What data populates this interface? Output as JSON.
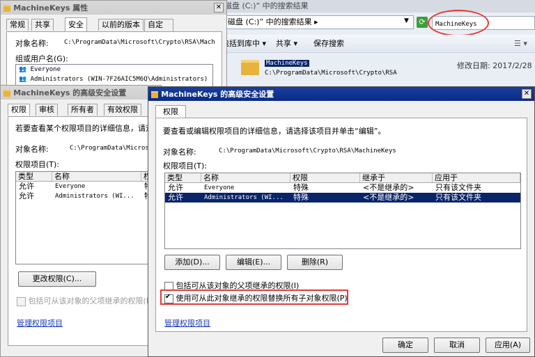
{
  "explorer": {
    "title": "磁盘 (C:)” 中的搜索结果",
    "address": "磁盘 (C:)” 中的搜索结果 ▸",
    "search_value": "MachineKeys",
    "toolbar": [
      "包括到库中 ▾",
      "共享 ▾",
      "保存搜索"
    ],
    "result_name": "MachineKeys",
    "result_path": "C:\\ProgramData\\Microsoft\\Crypto\\RSA",
    "result_date": "修改日期: 2017/2/28 20"
  },
  "props": {
    "title": "MachineKeys 属性",
    "tabs": [
      "常规",
      "共享",
      "安全",
      "以前的版本",
      "自定义"
    ],
    "object_label": "对象名称:",
    "object_value": "C:\\ProgramData\\Microsoft\\Crypto\\RSA\\Mach",
    "group_label": "组或用户名(G):",
    "users": [
      "Everyone",
      "Administrators (WIN-7F26AIC5M6Q\\Administrators)"
    ]
  },
  "adv1": {
    "title": "MachineKeys 的高级安全设置",
    "tabs": [
      "权限",
      "审核",
      "所有者",
      "有效权限"
    ],
    "desc": "若要查看某个权限项目的详细信息，请双",
    "object_label": "对象名称:",
    "object_value": "C:\\ProgramData\\Micros",
    "entries_label": "权限项目(T):",
    "headers": [
      "类型",
      "名称",
      "权"
    ],
    "rows": [
      {
        "type": "允许",
        "name": "Everyone",
        "perm": "特"
      },
      {
        "type": "允许",
        "name": "Administrators (WI...",
        "perm": "特"
      }
    ],
    "change_btn": "更改权限(C)...",
    "inherit_label": "包括可从该对象的父项继承的权限(I)",
    "manage_link": "管理权限项目"
  },
  "adv2": {
    "title": "MachineKeys 的高级安全设置",
    "tab": "权限",
    "desc": "要查看或编辑权限项目的详细信息，请选择该项目并单击“编辑”。",
    "object_label": "对象名称:",
    "object_value": "C:\\ProgramData\\Microsoft\\Crypto\\RSA\\MachineKeys",
    "entries_label": "权限项目(T):",
    "headers": [
      "类型",
      "名称",
      "权限",
      "继承于",
      "应用于"
    ],
    "rows": [
      {
        "type": "允许",
        "name": "Everyone",
        "perm": "特殊",
        "inherit": "<不是继承的>",
        "apply": "只有该文件夹"
      },
      {
        "type": "允许",
        "name": "Administrators (WI...",
        "perm": "特殊",
        "inherit": "<不是继承的>",
        "apply": "只有该文件夹"
      }
    ],
    "add_btn": "添加(D)...",
    "edit_btn": "编辑(E)...",
    "delete_btn": "删除(R)",
    "inherit_label": "包括可从该对象的父项继承的权限(I)",
    "replace_label": "使用可从此对象继承的权限替换所有子对象权限(P)",
    "manage_link": "管理权限项目",
    "ok_btn": "确定",
    "cancel_btn": "取消",
    "apply_btn": "应用(A)"
  }
}
